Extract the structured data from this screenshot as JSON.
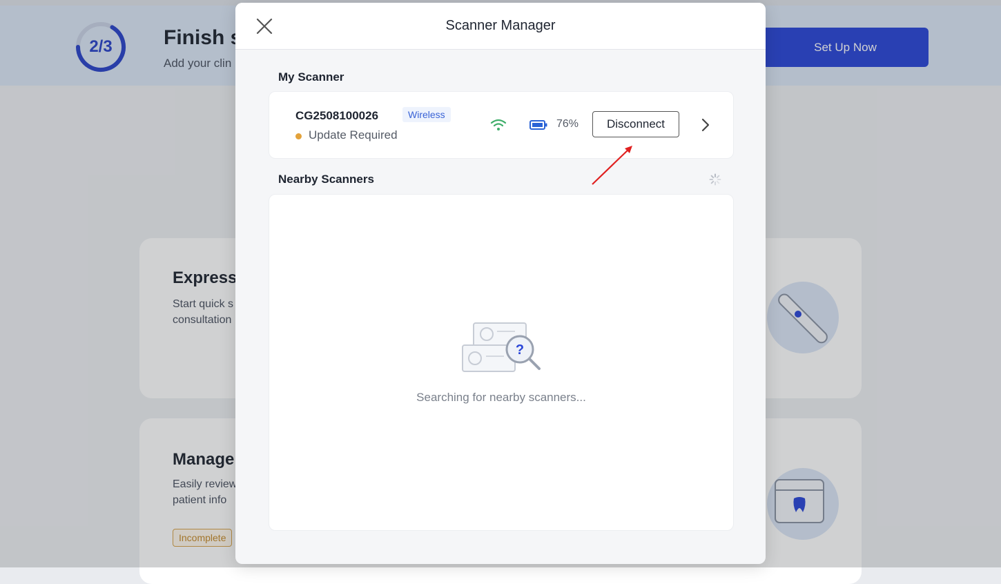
{
  "background": {
    "banner": {
      "progress": "2/3",
      "title": "Finish s",
      "subtitle": "Add your clin",
      "setup_button": "Set Up Now"
    },
    "cards": [
      {
        "title": "Express",
        "desc": "Start quick s consultation"
      },
      {
        "title": "Manage",
        "desc": "Easily review patient info",
        "badge": "Incomplete"
      }
    ]
  },
  "modal": {
    "title": "Scanner Manager",
    "my_scanner": {
      "section_title": "My Scanner",
      "serial": "CG2508100026",
      "connection": "Wireless",
      "status": "Update Required",
      "battery": "76%",
      "disconnect_label": "Disconnect"
    },
    "nearby": {
      "section_title": "Nearby Scanners",
      "empty_text": "Searching for nearby scanners..."
    }
  },
  "icons": {
    "close": "close-icon",
    "wifi": "wifi-icon",
    "battery": "battery-icon",
    "chevron": "chevron-right-icon",
    "spinner": "spinner-icon"
  },
  "colors": {
    "accent": "#2a46d8",
    "status_warning": "#e3a23b",
    "wifi_green": "#3fae6a",
    "battery_blue": "#2a63d6",
    "annotation": "#e02020"
  }
}
